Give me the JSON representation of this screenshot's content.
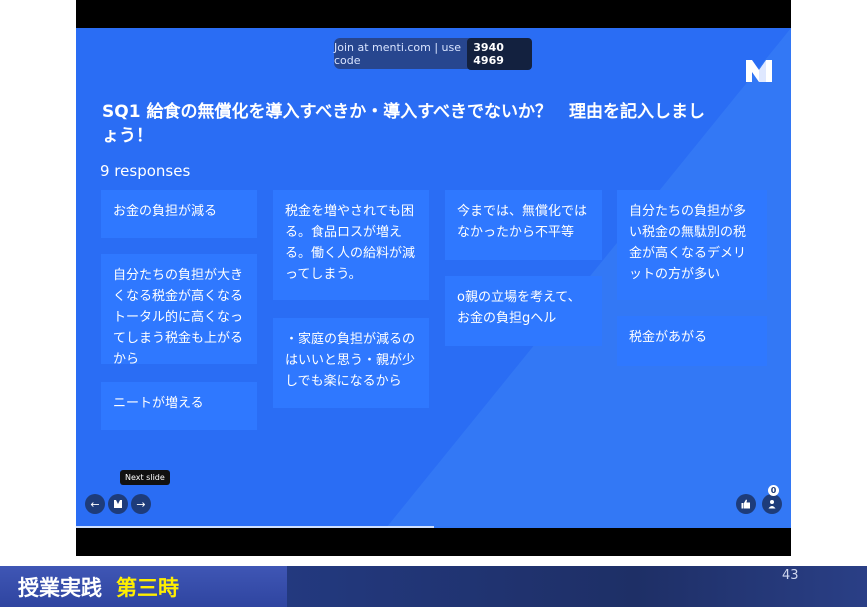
{
  "join_bar": {
    "prefix": "Join at menti.com | use code",
    "code": "3940 4969"
  },
  "question": {
    "title": "SQ1 給食の無償化を導入すべきか・導入すべきでないか？　理由を記入しましょう！"
  },
  "responses_count": "9 responses",
  "responses": {
    "c1": "お金の負担が減る",
    "c2": "自分たちの負担が大きくなる税金が高くなる　トータル的に高くなってしまう税金も上がるから",
    "c3": "ニートが増える",
    "c4": "税金を増やされても困る。食品ロスが増える。働く人の給料が減ってしまう。",
    "c5": "・家庭の負担が減るのはいいと思う・親が少しでも楽になるから",
    "c6": "今までは、無償化ではなかったから不平等",
    "c7": "o親の立場を考えて、お金の負担gヘル",
    "c8": "自分たちの負担が多い税金の無駄別の税金が高くなるデメリットの方が多い",
    "c9": "税金があがる"
  },
  "controls": {
    "tooltip": "Next slide",
    "prev_icon": "←",
    "next_icon": "→",
    "participants_count": "0"
  },
  "footer": {
    "title_main": "授業実践",
    "title_highlight": "第三時",
    "page_number": "43"
  },
  "colors": {
    "slide_bg": "#2a6df4",
    "card_bg": "#2f78ff",
    "highlight": "#ffee00"
  }
}
